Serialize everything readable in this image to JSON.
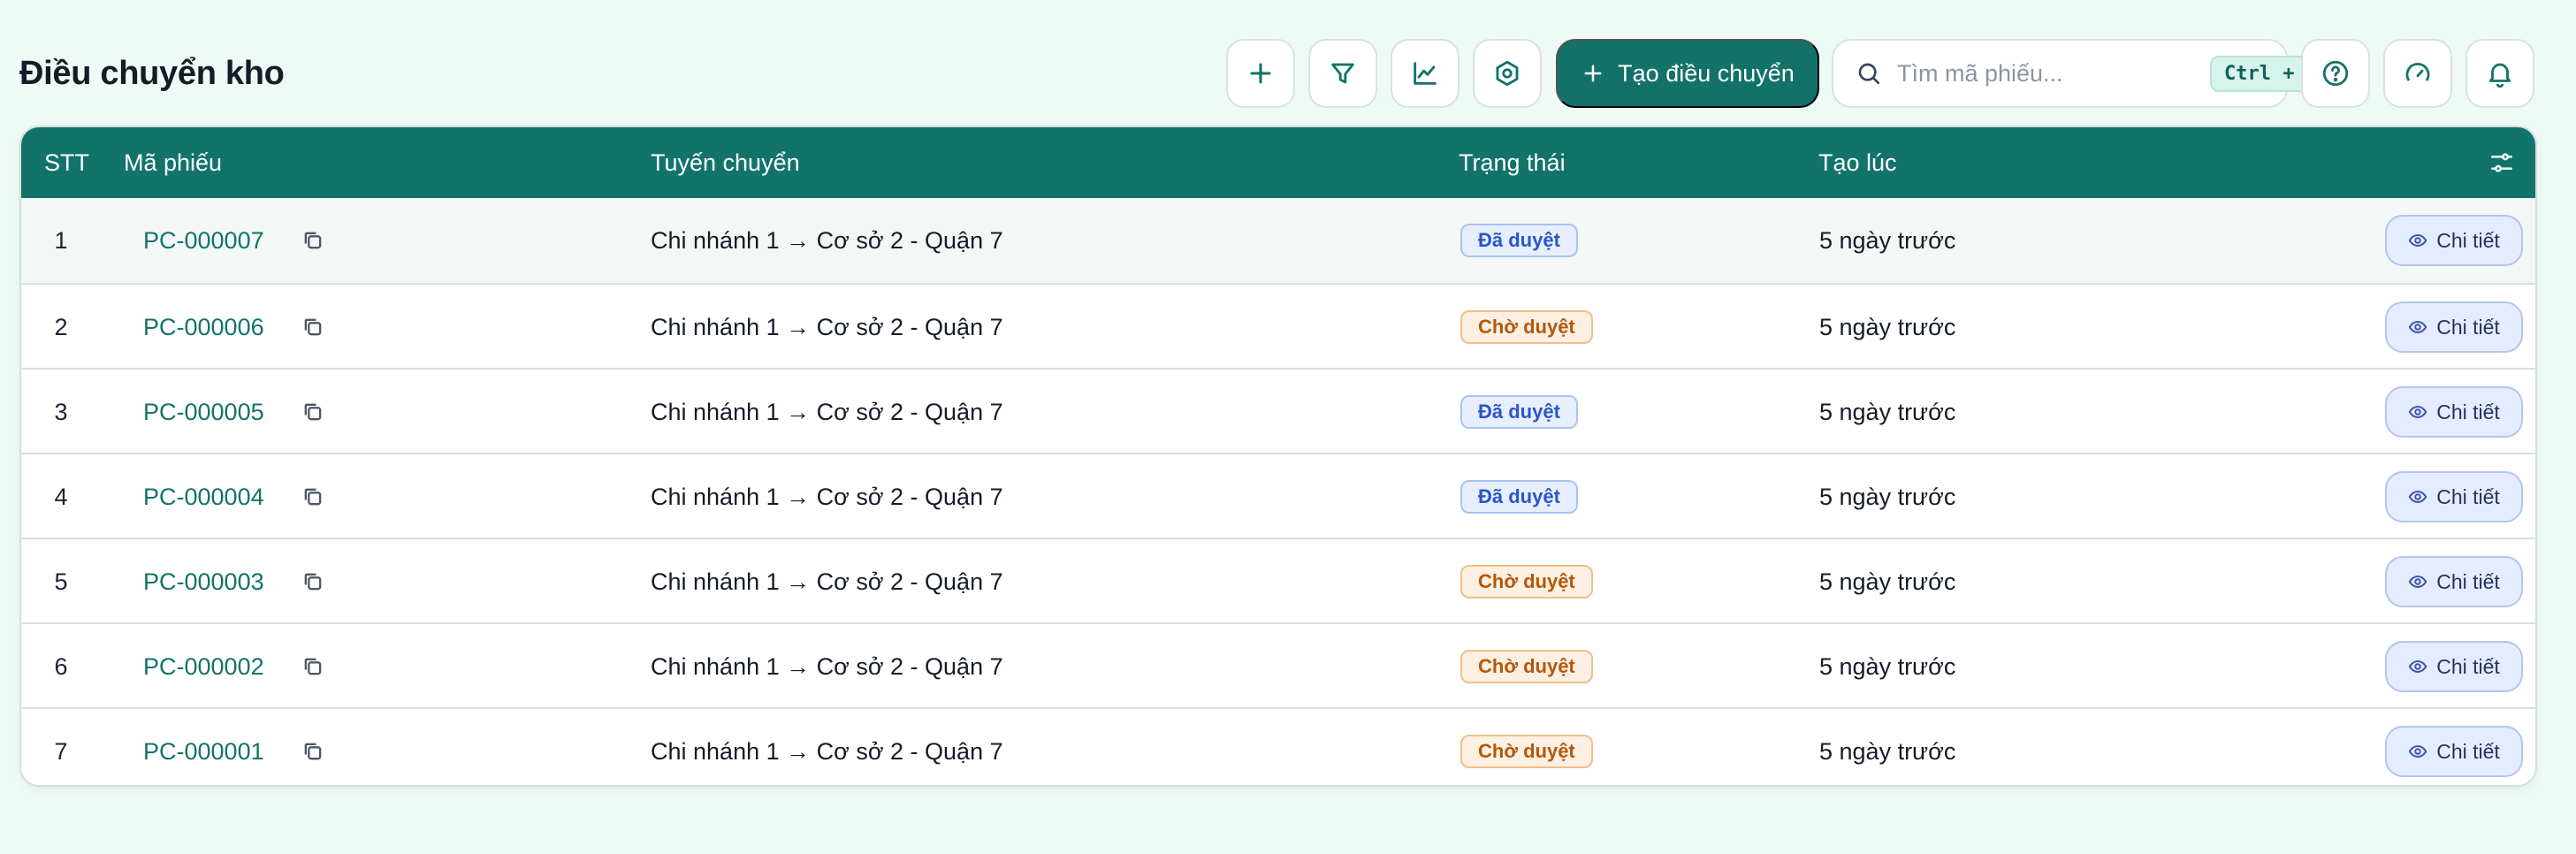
{
  "page": {
    "title": "Điều chuyển kho"
  },
  "toolbar": {
    "add_icon": "plus-icon",
    "filter_icon": "filter-icon",
    "chart_icon": "chart-line-icon",
    "settings_icon": "hexagon-gear-icon",
    "create_label": "Tạo điều chuyển",
    "search_placeholder": "Tìm mã phiếu...",
    "search_value": "",
    "shortcut": "Ctrl + K",
    "help_icon": "help-circle-icon",
    "dashboard_icon": "gauge-icon",
    "notification_icon": "bell-icon"
  },
  "table": {
    "headers": {
      "stt": "STT",
      "code": "Mã phiếu",
      "route": "Tuyến chuyển",
      "status": "Trạng thái",
      "created": "Tạo lúc"
    },
    "column_settings_icon": "sliders-icon",
    "detail_label": "Chi tiết",
    "rows": [
      {
        "stt": "1",
        "code": "PC-000007",
        "route": "Chi nhánh 1 → Cơ sở 2 - Quận 7",
        "status": "Đã duyệt",
        "status_kind": "approved",
        "created": "5 ngày trước"
      },
      {
        "stt": "2",
        "code": "PC-000006",
        "route": "Chi nhánh 1 → Cơ sở 2 - Quận 7",
        "status": "Chờ duyệt",
        "status_kind": "pending",
        "created": "5 ngày trước"
      },
      {
        "stt": "3",
        "code": "PC-000005",
        "route": "Chi nhánh 1 → Cơ sở 2 - Quận 7",
        "status": "Đã duyệt",
        "status_kind": "approved",
        "created": "5 ngày trước"
      },
      {
        "stt": "4",
        "code": "PC-000004",
        "route": "Chi nhánh 1 → Cơ sở 2 - Quận 7",
        "status": "Đã duyệt",
        "status_kind": "approved",
        "created": "5 ngày trước"
      },
      {
        "stt": "5",
        "code": "PC-000003",
        "route": "Chi nhánh 1 → Cơ sở 2 - Quận 7",
        "status": "Chờ duyệt",
        "status_kind": "pending",
        "created": "5 ngày trước"
      },
      {
        "stt": "6",
        "code": "PC-000002",
        "route": "Chi nhánh 1 → Cơ sở 2 - Quận 7",
        "status": "Chờ duyệt",
        "status_kind": "pending",
        "created": "5 ngày trước"
      },
      {
        "stt": "7",
        "code": "PC-000001",
        "route": "Chi nhánh 1 → Cơ sở 2 - Quận 7",
        "status": "Chờ duyệt",
        "status_kind": "pending",
        "created": "5 ngày trước"
      }
    ]
  },
  "colors": {
    "brand": "#137268",
    "background": "#effaf7",
    "approved": "#2b56c9",
    "pending": "#b4570b"
  }
}
